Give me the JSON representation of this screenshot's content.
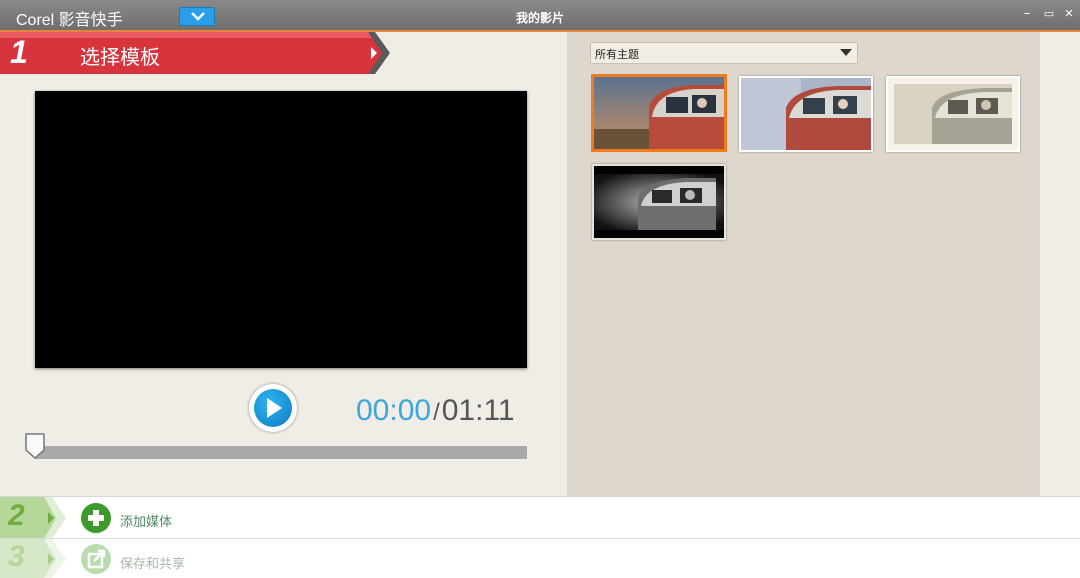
{
  "app": {
    "title": "Corel 影音快手",
    "window_title": "我的影片",
    "controls": {
      "minimize": "–",
      "restore": "▭",
      "close": "✕"
    },
    "accent": "#e8843a"
  },
  "step1": {
    "number": "1",
    "label": "选择模板",
    "color": "#d8343e"
  },
  "player": {
    "current_time": "00:00",
    "separator": "/",
    "total_time": "01:11",
    "progress": 0
  },
  "themes": {
    "selected_filter": "所有主题",
    "items": [
      {
        "name": "thumb-warm",
        "selected": true
      },
      {
        "name": "thumb-collage",
        "selected": false
      },
      {
        "name": "thumb-sepia",
        "selected": false
      },
      {
        "name": "thumb-bw",
        "selected": false
      }
    ]
  },
  "step2": {
    "number": "2",
    "label": "添加媒体",
    "color": "#6fae3c"
  },
  "step3": {
    "number": "3",
    "label": "保存和共享",
    "color": "#a9cf8c"
  }
}
